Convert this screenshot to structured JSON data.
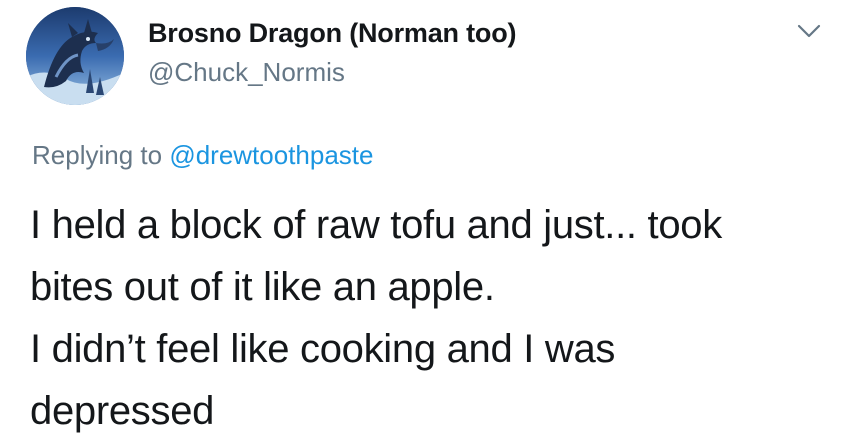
{
  "author": {
    "display_name": "Brosno Dragon (Norman too)",
    "handle": "@Chuck_Normis",
    "avatar_icon": "dragon-avatar"
  },
  "menu": {
    "icon": "chevron-down-icon"
  },
  "reply": {
    "prefix": "Replying to",
    "mention": "@drewtoothpaste"
  },
  "tweet": {
    "lines": [
      "I held a block of raw tofu and just... took",
      "bites out of it like an apple.",
      "I didn’t feel like cooking and I was",
      "depressed"
    ]
  },
  "colors": {
    "primary_text": "#14171a",
    "secondary_text": "#657786",
    "link": "#1b95e0"
  }
}
